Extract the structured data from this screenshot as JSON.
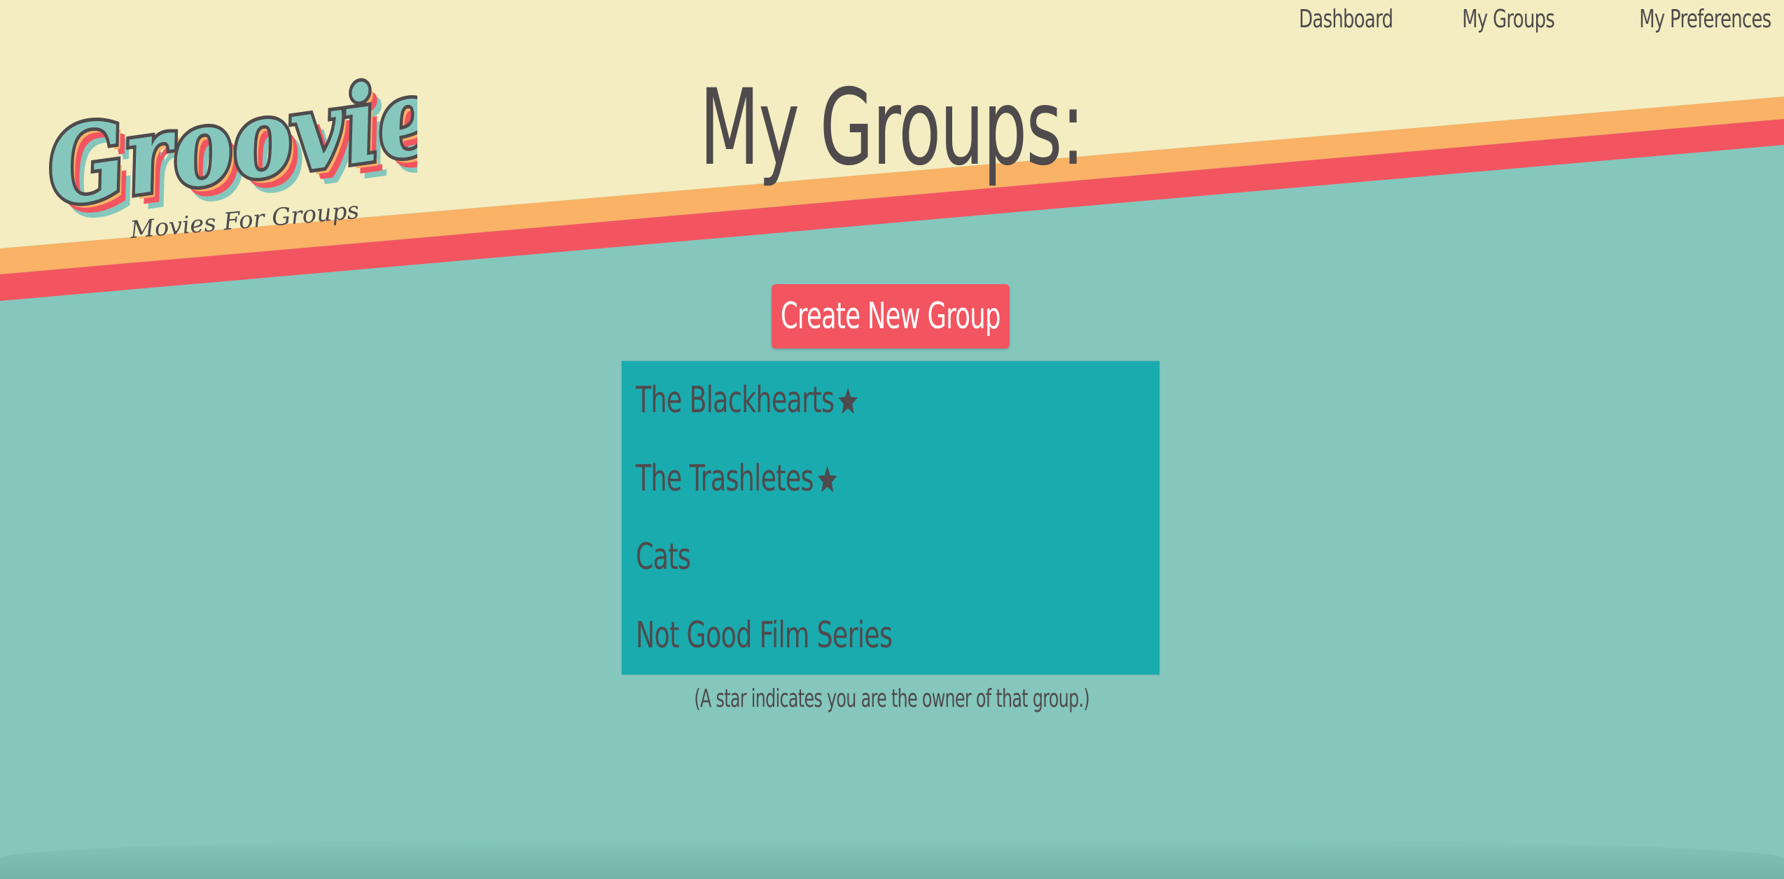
{
  "app": {
    "brand_name": "Groovies",
    "brand_tagline": "Movies For Groups"
  },
  "nav": {
    "items": [
      {
        "label": "Dashboard"
      },
      {
        "label": "My Groups"
      },
      {
        "label": "My Preferences"
      }
    ]
  },
  "page": {
    "title": "My Groups:"
  },
  "actions": {
    "create_group_label": "Create New Group"
  },
  "groups": [
    {
      "name": "The Blackhearts",
      "owner": true
    },
    {
      "name": "The Trashletes",
      "owner": true
    },
    {
      "name": "Cats",
      "owner": false
    },
    {
      "name": "Not Good Film Series",
      "owner": false
    }
  ],
  "footnote": "(A star indicates you are the owner of that group.)",
  "colors": {
    "cream": "#f3edc1",
    "orange_stripe": "#f9b266",
    "red_stripe": "#f25560",
    "teal_background": "#85c7bd",
    "list_teal": "#1aabaf",
    "text_dark": "#4f4a4c",
    "button_red": "#f25560"
  }
}
